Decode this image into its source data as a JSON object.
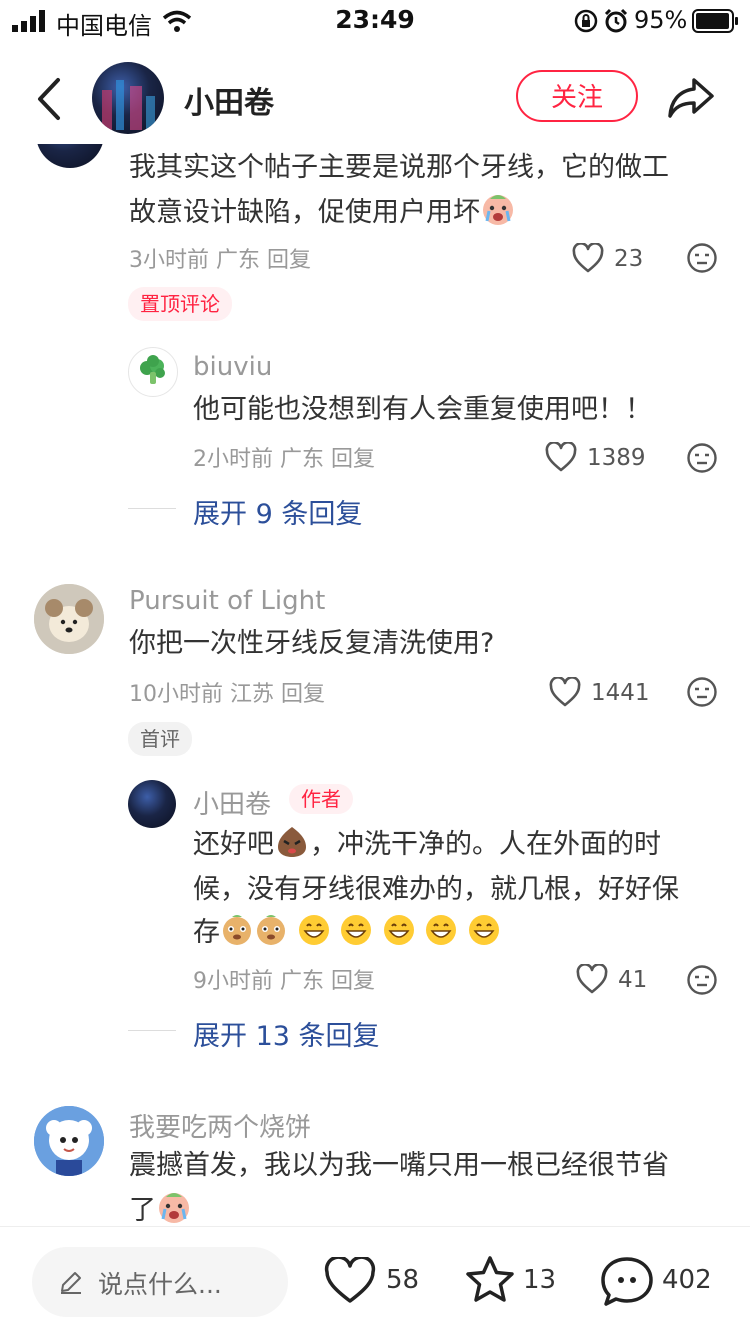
{
  "status_bar": {
    "carrier": "中国电信",
    "time": "23:49",
    "battery": "95%"
  },
  "header": {
    "title": "小田卷",
    "follow_label": "关注"
  },
  "comments": [
    {
      "text_line1": "我其实这个帖子主要是说那个牙线，它的做工",
      "text_line2": "故意设计缺陷，促使用户用坏",
      "meta": "3小时前 广东 回复",
      "likes": "23",
      "pin_label": "置顶评论",
      "reply": {
        "name": "biuviu",
        "text": "他可能也没想到有人会重复使用吧！！",
        "meta": "2小时前 广东 回复",
        "likes": "1389"
      },
      "expand_label": "展开 9 条回复"
    },
    {
      "name": "Pursuit of Light",
      "text": "你把一次性牙线反复清洗使用?",
      "meta": "10小时前 江苏 回复",
      "likes": "1441",
      "first_label": "首评",
      "reply": {
        "name": "小田卷",
        "author_label": "作者",
        "text_line1": "还好吧",
        "text_line1b": "，冲洗干净的。人在外面的时",
        "text_line2": "候，没有牙线很难办的，就几根，好好保",
        "text_line3": "存",
        "meta": "9小时前 广东 回复",
        "likes": "41"
      },
      "expand_label": "展开 13 条回复"
    },
    {
      "name": "我要吃两个烧饼",
      "text_line1": "震撼首发，我以为我一嘴只用一根已经很节省",
      "text_line2": "了"
    }
  ],
  "bottom_bar": {
    "input_placeholder": "说点什么...",
    "likes": "58",
    "stars": "13",
    "comments": "402"
  },
  "colors": {
    "accent": "#ff2442",
    "link": "#2c4f9a"
  }
}
